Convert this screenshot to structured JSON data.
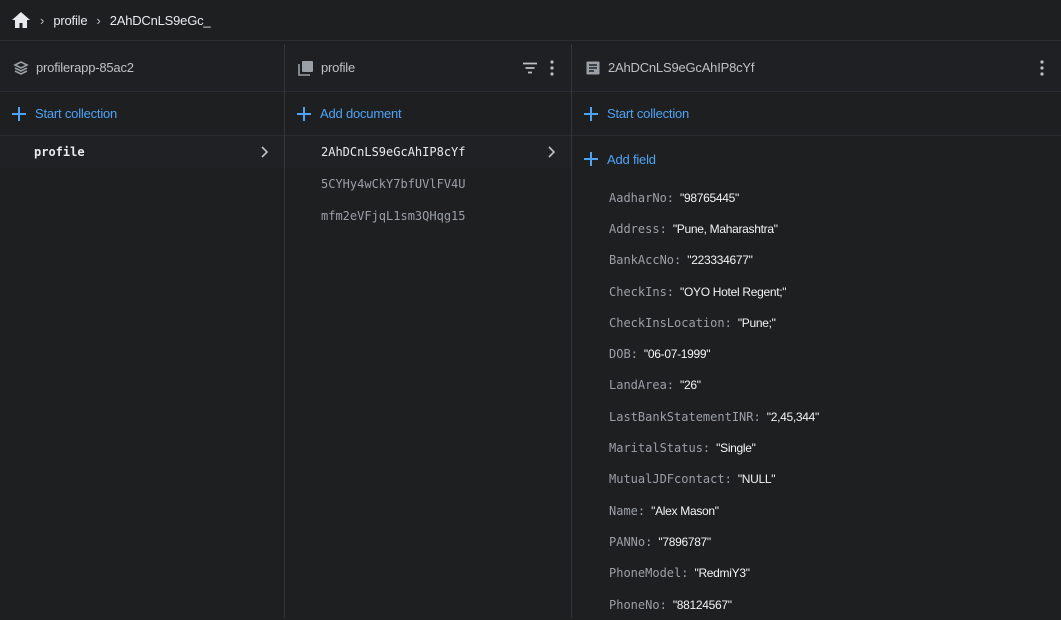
{
  "breadcrumb": {
    "home_icon": "home-icon",
    "items": [
      "profile",
      "2AhDCnLS9eGc_"
    ]
  },
  "colors": {
    "background": "#1e1f21",
    "accent": "#4ea3f5",
    "text": "#e8eaed",
    "muted": "#9aa0a6"
  },
  "root_panel": {
    "title": "profilerapp-85ac2",
    "icon": "layers-icon",
    "add_label": "Start collection",
    "items": [
      "profile"
    ]
  },
  "collection_panel": {
    "title": "profile",
    "icon": "collection-icon",
    "add_label": "Add document",
    "items": [
      "2AhDCnLS9eGcAhIP8cYf",
      "5CYHy4wCkY7bfUVlFV4U",
      "mfm2eVFjqL1sm3QHqg15"
    ]
  },
  "document_panel": {
    "title": "2AhDCnLS9eGcAhIP8cYf",
    "icon": "document-icon",
    "start_collection_label": "Start collection",
    "add_field_label": "Add field",
    "fields": [
      {
        "key": "AadharNo",
        "value": "\"98765445\""
      },
      {
        "key": "Address",
        "value": "\"Pune, Maharashtra\""
      },
      {
        "key": "BankAccNo",
        "value": "\"223334677\""
      },
      {
        "key": "CheckIns",
        "value": "\"OYO Hotel Regent;\""
      },
      {
        "key": "CheckInsLocation",
        "value": "\"Pune;\""
      },
      {
        "key": "DOB",
        "value": "\"06-07-1999\""
      },
      {
        "key": "LandArea",
        "value": "\"26\""
      },
      {
        "key": "LastBankStatementINR",
        "value": "\"2,45,344\""
      },
      {
        "key": "MaritalStatus",
        "value": "\"Single\""
      },
      {
        "key": "MutualJDFcontact",
        "value": "\"NULL\""
      },
      {
        "key": "Name",
        "value": "\"Alex Mason\""
      },
      {
        "key": "PANNo",
        "value": "\"7896787\""
      },
      {
        "key": "PhoneModel",
        "value": "\"RedmiY3\""
      },
      {
        "key": "PhoneNo",
        "value": "\"88124567\""
      }
    ]
  }
}
